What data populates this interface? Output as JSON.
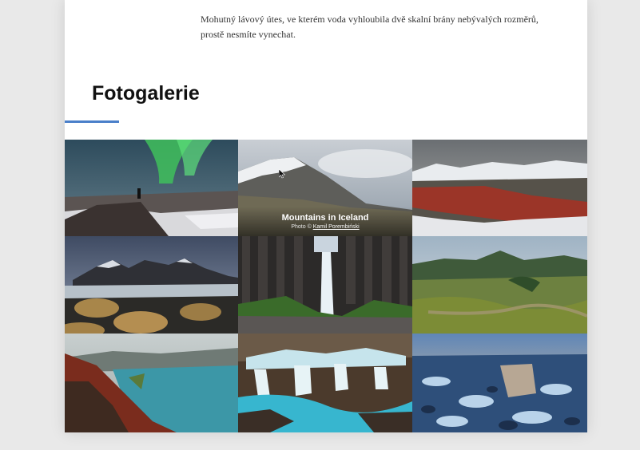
{
  "intro": {
    "text": "Mohutný lávový útes, ve kterém voda vyhloubila dvě skalní brány nebývalých rozměrů, prostě nesmíte vynechat."
  },
  "gallery": {
    "title": "Fotogalerie",
    "accent_color": "#4a7fc9",
    "featured_caption": {
      "title": "Mountains in Iceland",
      "credit_prefix": "Photo © ",
      "credit_author": "Kamil Porembiński"
    },
    "photos": [
      {
        "subject": "aurora-over-rocky-plateau"
      },
      {
        "subject": "snowy-mountain-peak"
      },
      {
        "subject": "red-volcanic-valley"
      },
      {
        "subject": "vestrahorn-dunes"
      },
      {
        "subject": "svartifoss-basalt-waterfall"
      },
      {
        "subject": "green-highlands"
      },
      {
        "subject": "crater-lake"
      },
      {
        "subject": "bruarfoss-turquoise-cascades"
      },
      {
        "subject": "glacier-lagoon-ice"
      }
    ]
  }
}
